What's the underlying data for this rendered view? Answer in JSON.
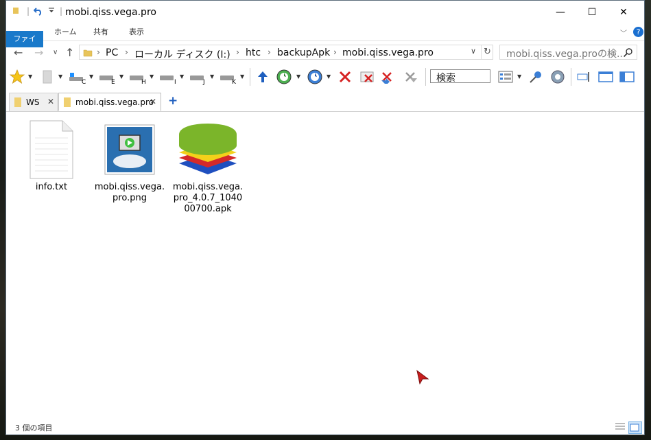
{
  "window": {
    "title": "mobi.qiss.vega.pro",
    "controls": {
      "minimize": "—",
      "maximize": "☐",
      "close": "✕"
    }
  },
  "ribbon": {
    "tabs": [
      "ファイル",
      "ホーム",
      "共有",
      "表示"
    ]
  },
  "address": {
    "crumbs": [
      "PC",
      "ローカル ディスク (I:)",
      "htc",
      "backupApk",
      "mobi.qiss.vega.pro"
    ],
    "search_placeholder": "mobi.qiss.vega.proの検..."
  },
  "toolbar": {
    "drive_letters": [
      "C",
      "E",
      "H",
      "I",
      "J",
      "K"
    ],
    "search_label": "検索"
  },
  "folder_tabs": [
    {
      "label": "WS",
      "active": false
    },
    {
      "label": "mobi.qiss.vega.pro",
      "active": true
    }
  ],
  "files": [
    {
      "name": "info.txt",
      "icon": "text-file-icon"
    },
    {
      "name": "mobi.qiss.vega.pro.png",
      "icon": "png-image-icon"
    },
    {
      "name": "mobi.qiss.vega.pro_4.0.7_104000700.apk",
      "icon": "bluestacks-apk-icon"
    }
  ],
  "status": {
    "item_count": "3 個の項目"
  },
  "colors": {
    "accent": "#1979ca",
    "file_tab": "#1979ca",
    "close_red": "#d62222"
  }
}
